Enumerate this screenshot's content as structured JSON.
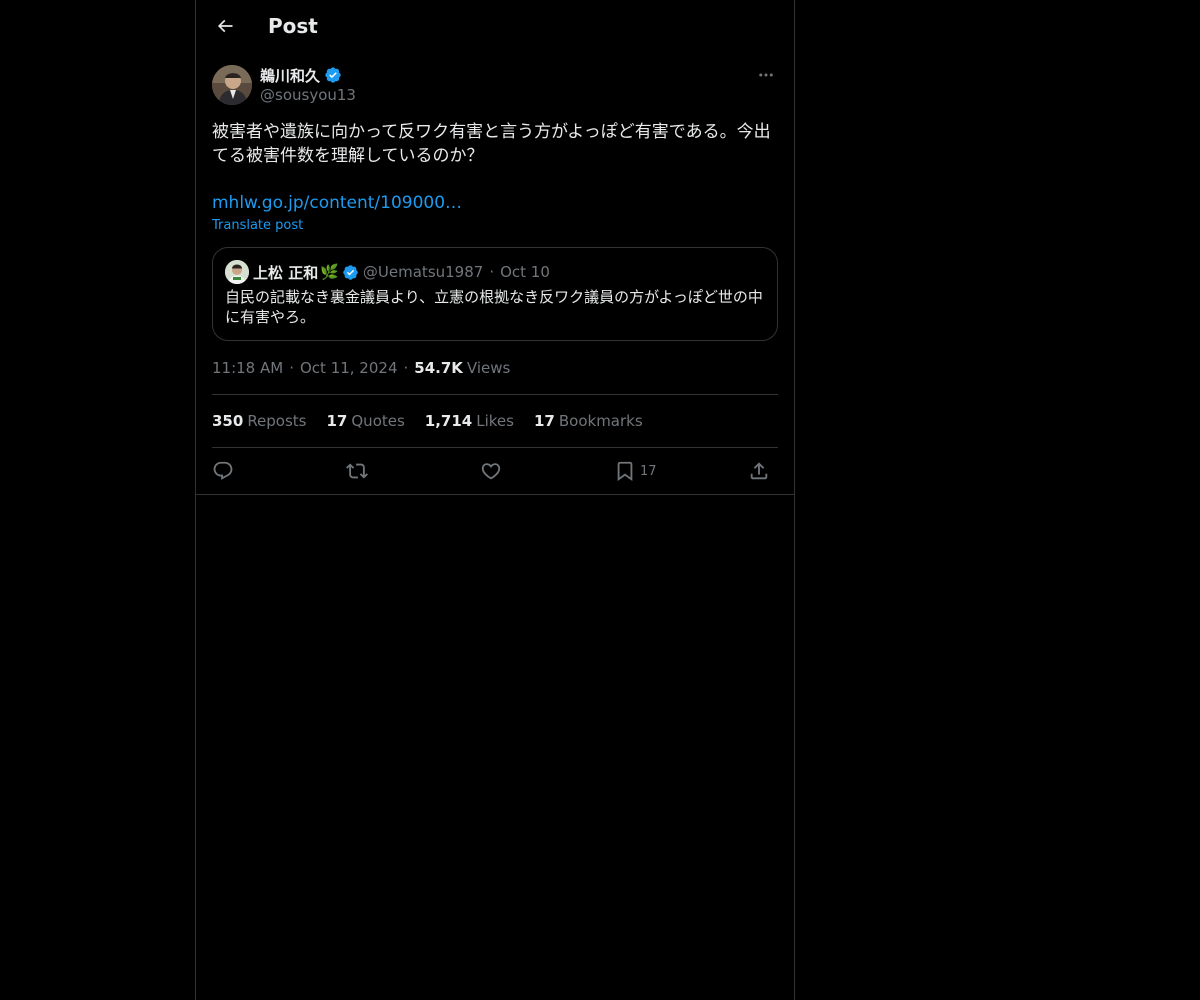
{
  "header": {
    "title": "Post"
  },
  "author": {
    "name": "鵜川和久",
    "handle": "@sousyou13",
    "verified": true
  },
  "post": {
    "text": "被害者や遺族に向かって反ワク有害と言う方がよっぽど有害である。今出てる被害件数を理解しているのか？",
    "link": "mhlw.go.jp/content/109000…",
    "translate_label": "Translate post"
  },
  "quote": {
    "name": "上松 正和",
    "emoji": "🌿",
    "handle": "@Uematsu1987",
    "separator": "·",
    "date": "Oct 10",
    "text": "自民の記載なき裏金議員より、立憲の根拠なき反ワク議員の方がよっぽど世の中に有害やろ。"
  },
  "meta": {
    "time": "11:18 AM",
    "separator": "·",
    "date": "Oct 11, 2024",
    "views_count": "54.7K",
    "views_label": "Views"
  },
  "stats": {
    "reposts_count": "350",
    "reposts_label": "Reposts",
    "quotes_count": "17",
    "quotes_label": "Quotes",
    "likes_count": "1,714",
    "likes_label": "Likes",
    "bookmarks_count": "17",
    "bookmarks_label": "Bookmarks"
  },
  "actions": {
    "reply_icon": "reply-icon",
    "repost_icon": "repost-icon",
    "like_icon": "heart-icon",
    "bookmark_icon": "bookmark-icon",
    "bookmark_count": "17",
    "share_icon": "share-icon"
  },
  "colors": {
    "background": "#000000",
    "text_primary": "#e7e9ea",
    "text_secondary": "#71767b",
    "accent": "#1d9bf0",
    "border": "#2f3336"
  }
}
